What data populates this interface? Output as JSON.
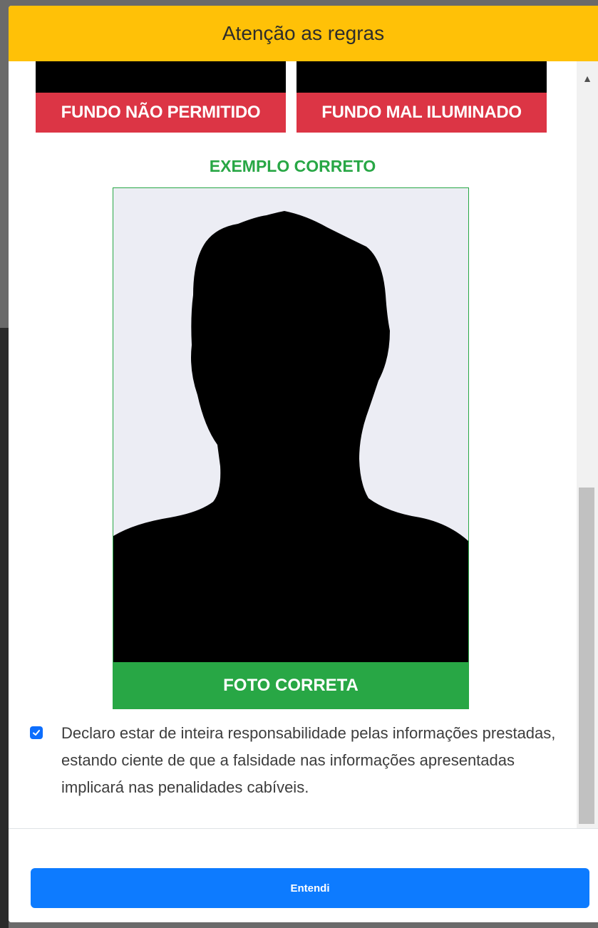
{
  "modal": {
    "title": "Atenção as regras",
    "header_color": "#ffc107"
  },
  "rules": {
    "bad_examples": [
      {
        "label": "FUNDO NÃO PERMITIDO"
      },
      {
        "label": "FUNDO MAL ILUMINADO"
      }
    ],
    "bad_color": "#dc3545",
    "good_example_title": "EXEMPLO CORRETO",
    "good_example_label": "FOTO CORRETA",
    "good_color": "#28a745"
  },
  "declaration": {
    "checked": true,
    "text": "Declaro estar de inteira responsabilidade pelas informações prestadas, estando ciente de que a falsidade nas informações apresentadas implicará nas penalidades cabíveis."
  },
  "footer": {
    "confirm_label": "Entendi",
    "confirm_color": "#0d7bff"
  },
  "icons": {
    "scroll_up": "scroll-up-arrow-icon",
    "scroll_down": "scroll-down-arrow-icon",
    "checkbox": "check-icon"
  }
}
